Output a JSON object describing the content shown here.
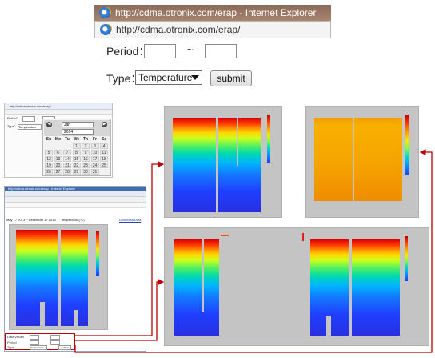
{
  "browser": {
    "title": "http://cdma.otronix.com/erap - Internet Explorer",
    "address": "http://cdma.otronix.com/erap/"
  },
  "form": {
    "period_label": "Period：",
    "tilde": "~",
    "type_label": "Type：",
    "type_selected": "Temperature",
    "submit_label": "submit"
  },
  "calendar": {
    "month": "Jan",
    "year": "2014",
    "weekdays": [
      "Su",
      "Mo",
      "Tu",
      "We",
      "Th",
      "Fr",
      "Sa"
    ],
    "days": [
      [
        "",
        "",
        "",
        "1",
        "2",
        "3",
        "4"
      ],
      [
        "5",
        "6",
        "7",
        "8",
        "9",
        "10",
        "11"
      ],
      [
        "12",
        "13",
        "14",
        "15",
        "16",
        "17",
        "18"
      ],
      [
        "19",
        "20",
        "21",
        "22",
        "23",
        "24",
        "25"
      ],
      [
        "26",
        "27",
        "28",
        "29",
        "30",
        "31",
        ""
      ]
    ]
  },
  "result_page": {
    "date_range": "May 17 2013 ~ December 17 2013",
    "plot_title": "Temperature(°C)",
    "download_label": "Download Data",
    "form_rows": [
      "Data values",
      "Period",
      "Type"
    ],
    "type_value": "Temperature",
    "submit_label": "submit"
  },
  "colors": {
    "arrow": "#c00000",
    "panel_bg": "#c4c4c4"
  }
}
